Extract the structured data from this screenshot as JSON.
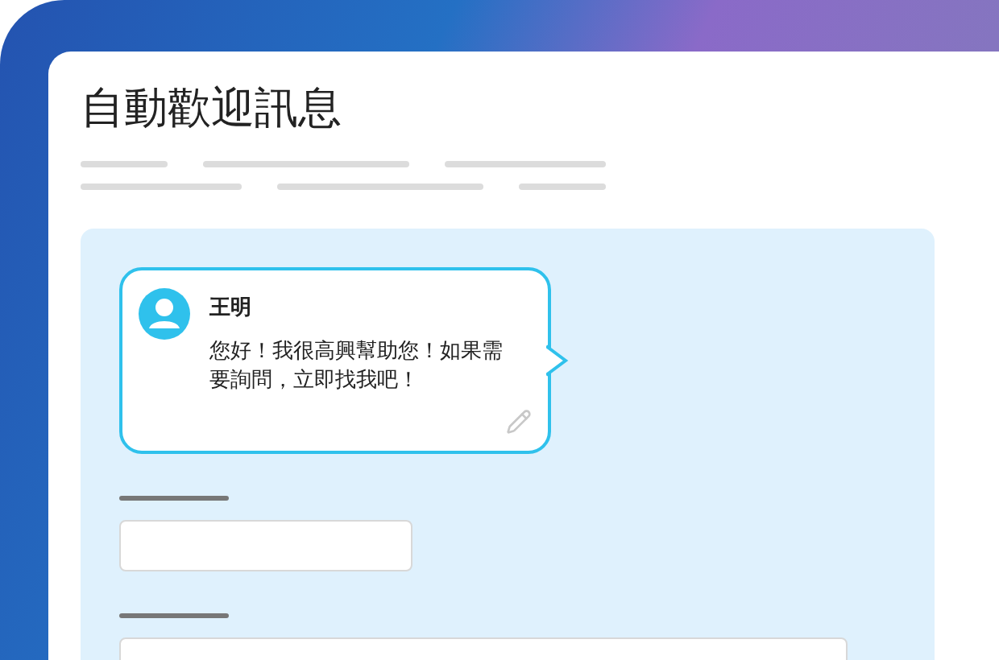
{
  "title": "自動歡迎訊息",
  "message": {
    "sender": "王明",
    "text": "您好！我很高興幫助您！如果需要詢問，立即找我吧！"
  }
}
